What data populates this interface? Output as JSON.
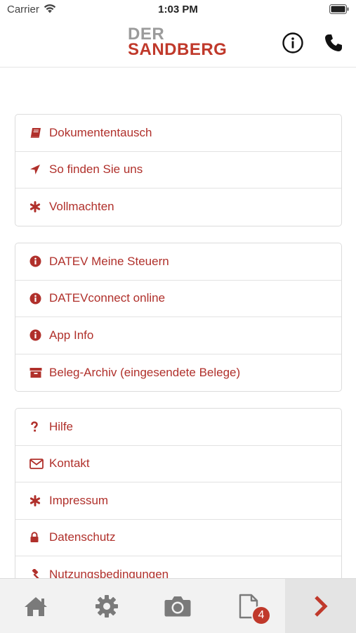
{
  "status_bar": {
    "carrier": "Carrier",
    "time": "1:03 PM"
  },
  "header": {
    "logo_line1": "DER",
    "logo_line2": "SANDBERG"
  },
  "colors": {
    "accent": "#b0302b",
    "logo_gray": "#9b9b9b",
    "tab_icon": "#7a7a7a"
  },
  "groups": [
    {
      "items": [
        {
          "label": "Dokumententausch",
          "icon": "book-icon"
        },
        {
          "label": "So finden Sie uns",
          "icon": "location-arrow-icon"
        },
        {
          "label": "Vollmachten",
          "icon": "asterisk-icon"
        }
      ]
    },
    {
      "items": [
        {
          "label": "DATEV Meine Steuern",
          "icon": "info-circle-icon"
        },
        {
          "label": "DATEVconnect online",
          "icon": "info-circle-icon"
        },
        {
          "label": "App Info",
          "icon": "info-circle-icon"
        },
        {
          "label": "Beleg-Archiv (eingesendete Belege)",
          "icon": "archive-icon"
        }
      ]
    },
    {
      "items": [
        {
          "label": "Hilfe",
          "icon": "question-icon"
        },
        {
          "label": "Kontakt",
          "icon": "envelope-icon"
        },
        {
          "label": "Impressum",
          "icon": "asterisk-icon"
        },
        {
          "label": "Datenschutz",
          "icon": "lock-icon"
        },
        {
          "label": "Nutzungsbedingungen",
          "icon": "gavel-icon"
        }
      ]
    }
  ],
  "tabbar": {
    "tabs": [
      "home-icon",
      "gear-icon",
      "camera-icon",
      "document-icon",
      "chevron-right-icon"
    ],
    "documents_badge": "4"
  }
}
